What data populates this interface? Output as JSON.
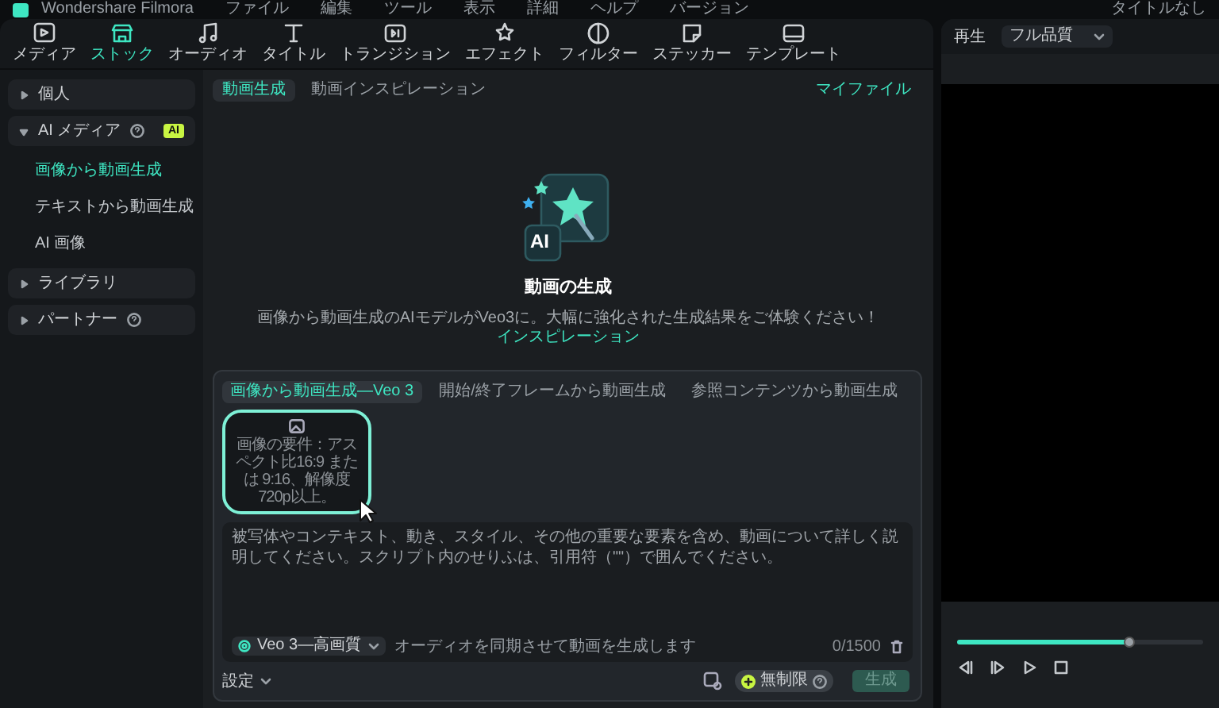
{
  "menu_bar": {
    "app_title": "Wondershare Filmora",
    "items": [
      "ファイル",
      "編集",
      "ツール",
      "表示",
      "詳細",
      "ヘルプ",
      "バージョン"
    ],
    "document_title": "タイトルなし"
  },
  "toolbar": [
    {
      "label": "メディア",
      "selected": false
    },
    {
      "label": "ストック",
      "selected": true
    },
    {
      "label": "オーディオ",
      "selected": false
    },
    {
      "label": "タイトル",
      "selected": false
    },
    {
      "label": "トランジション",
      "selected": false
    },
    {
      "label": "エフェクト",
      "selected": false
    },
    {
      "label": "フィルター",
      "selected": false
    },
    {
      "label": "ステッカー",
      "selected": false
    },
    {
      "label": "テンプレート",
      "selected": false
    }
  ],
  "sidebar": [
    {
      "label": "個人",
      "expanded": false,
      "help": false
    },
    {
      "label": "AI メディア",
      "expanded": true,
      "help": true,
      "badge": "AI",
      "children": [
        {
          "label": "画像から動画生成",
          "selected": true
        },
        {
          "label": "テキストから動画生成",
          "selected": false
        },
        {
          "label": "AI 画像",
          "selected": false
        }
      ]
    },
    {
      "label": "ライブラリ",
      "expanded": false,
      "help": false
    },
    {
      "label": "パートナー",
      "expanded": false,
      "help": true
    }
  ],
  "content_tabs": [
    {
      "label": "動画生成",
      "selected": true
    },
    {
      "label": "動画インスピレーション",
      "selected": false
    }
  ],
  "my_files": "マイファイル",
  "hero": {
    "art_label": "AI",
    "title": "動画の生成",
    "description": "画像から動画生成のAIモデルがVeo3に。大幅に強化された生成結果をご体験ください！",
    "link": "インスピレーション"
  },
  "generator": {
    "tabs": [
      {
        "label": "画像から動画生成—Veo 3",
        "selected": true
      },
      {
        "label": "開始/終了フレームから動画生成",
        "selected": false
      },
      {
        "label": "参照コンテンツから動画生成",
        "selected": false
      }
    ],
    "upload_hint": "画像の要件：アスペクト比16:9 または 9:16、解像度720p以上。",
    "prompt_placeholder": "被写体やコンテキスト、動き、スタイル、その他の重要な要素を含め、動画について詳しく説明してください。スクリプト内のせりふは、引用符（\"\"）で囲んでください。",
    "model": "Veo 3—高画質",
    "audio_hint": "オーディオを同期させて動画を生成します",
    "counter": "0/1500",
    "settings": "設定",
    "credits": "無制限",
    "generate": "生成",
    "generate_disabled": true
  },
  "preview": {
    "label": "再生",
    "quality": "フル品質",
    "progress": {
      "level": 0.7
    }
  }
}
